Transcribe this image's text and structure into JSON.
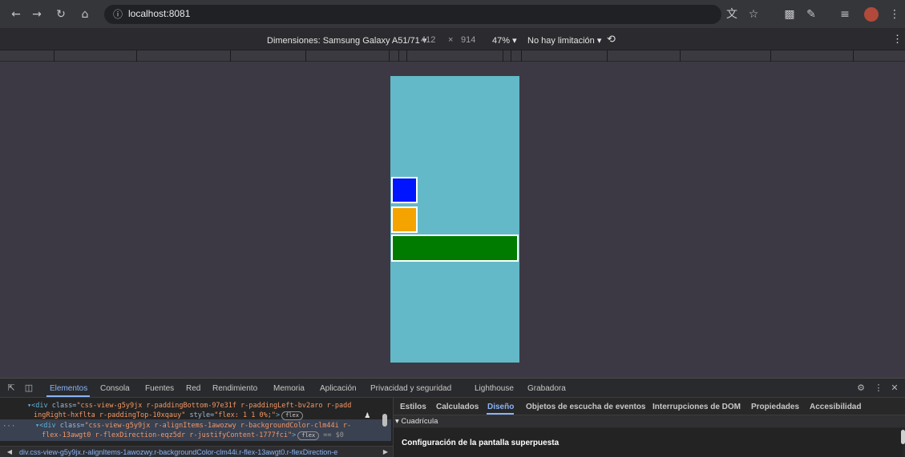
{
  "browser": {
    "url": "localhost:8081",
    "nav": {
      "back": "back-icon",
      "forward": "forward-icon",
      "reload": "reload-icon",
      "home": "home-icon"
    },
    "toolbar_icons": [
      "translate-icon",
      "star-icon",
      "qr-icon",
      "extensions-icon",
      "reading-list-icon",
      "profile-avatar",
      "menu-icon"
    ]
  },
  "device_toolbar": {
    "dimensions_label": "Dimensiones: Samsung Galaxy A51/71 ▾",
    "width": "412",
    "times": "×",
    "height": "914",
    "zoom": "47% ▾",
    "throttle": "No hay limitación ▾",
    "rotate_icon": "rotate-icon",
    "more_icon": "more-vert-icon"
  },
  "app": {
    "background_color": "#63b9c7",
    "boxes": [
      {
        "name": "blue",
        "color": "#0014ff"
      },
      {
        "name": "orange",
        "color": "#f4a300"
      },
      {
        "name": "green",
        "color": "#007b00"
      }
    ]
  },
  "devtools": {
    "tabs": [
      "Elementos",
      "Consola",
      "Fuentes",
      "Red",
      "Rendimiento",
      "Memoria",
      "Aplicación",
      "Privacidad y seguridad",
      "Lighthouse",
      "Grabadora"
    ],
    "active_tab": "Elementos",
    "elements": {
      "line1_tag": "▾<div ",
      "line1_attr": "class=",
      "line1_val": "\"css-view-g5y9jx r-paddingBottom-97e31f r-paddingLeft-bv2aro r-padd",
      "line2_val": "ingRight-hxflta r-paddingTop-10xqauy\"",
      "line2_attr": " style=",
      "line2_style": "\"flex: 1 1 0%;\"",
      "line2_end": ">",
      "pill_flex": "flex",
      "line3_tag": "▾<div ",
      "line3_attr": "class=",
      "line3_val": "\"css-view-g5y9jx r-alignItems-1awozwy r-backgroundColor-clm44i r-",
      "line4_val": "flex-13awgt0 r-flexDirection-eqz5dr r-justifyContent-1777fci\"",
      "line4_end": ">",
      "eq": "== $0",
      "gutter": "···"
    },
    "breadcrumb": "div.css-view-g5y9jx.r-alignItems-1awozwy.r-backgroundColor-clm44i.r-flex-13awgt0.r-flexDirection-e",
    "side_tabs": [
      "Estilos",
      "Calculados",
      "Diseño",
      "Objetos de escucha de eventos",
      "Interrupciones de DOM",
      "Propiedades",
      "Accesibilidad"
    ],
    "active_side_tab": "Diseño",
    "section_title": "▾ Cuadrícula",
    "overlay_title": "Configuración de la pantalla superpuesta",
    "icons": [
      "inspect-icon",
      "device-toggle-icon",
      "settings-icon",
      "more-vert-icon",
      "close-icon"
    ]
  }
}
